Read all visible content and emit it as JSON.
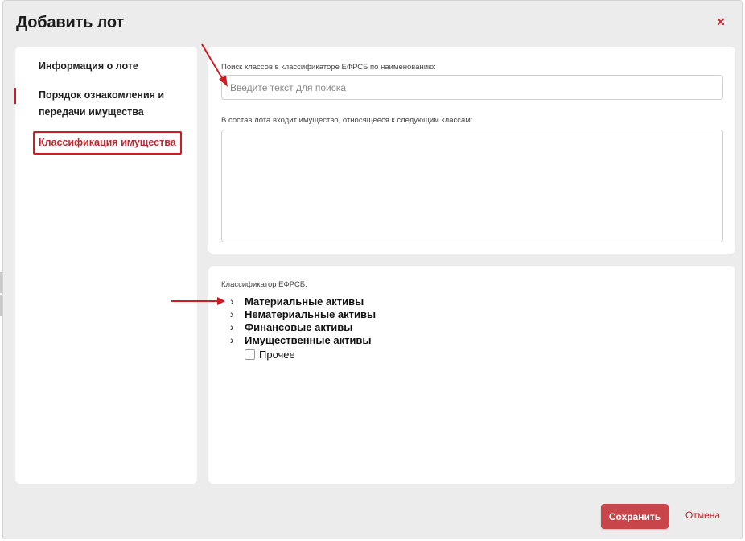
{
  "modal": {
    "title": "Добавить лот",
    "close_icon": "close-icon"
  },
  "sidebar": {
    "items": [
      {
        "label": "Информация о лоте",
        "active": false
      },
      {
        "label": "Порядок ознакомления и передачи имущества",
        "active": false
      },
      {
        "label": "Классификация имущества",
        "active": true
      }
    ]
  },
  "search": {
    "label": "Поиск классов в классификаторе ЕФРСБ по наименованию:",
    "placeholder": "Введите текст для поиска",
    "value": ""
  },
  "selected_classes": {
    "label": "В состав лота входит имущество, относящееся к следующим классам:"
  },
  "classifier": {
    "label": "Классификатор ЕФРСБ:",
    "nodes": [
      {
        "label": "Материальные активы",
        "icon": "chevron-right-icon"
      },
      {
        "label": "Нематериальные активы",
        "icon": "chevron-right-icon"
      },
      {
        "label": "Финансовые активы",
        "icon": "chevron-right-icon"
      },
      {
        "label": "Имущественные активы",
        "icon": "chevron-right-icon"
      }
    ],
    "leaf": {
      "label": "Прочее",
      "checked": false
    }
  },
  "footer": {
    "save_label": "Сохранить",
    "cancel_label": "Отмена"
  },
  "colors": {
    "accent": "#c0282d",
    "save_button": "#c8464a",
    "annotation": "#d11a22",
    "modal_bg": "#ececec",
    "panel_bg": "#ffffff"
  }
}
